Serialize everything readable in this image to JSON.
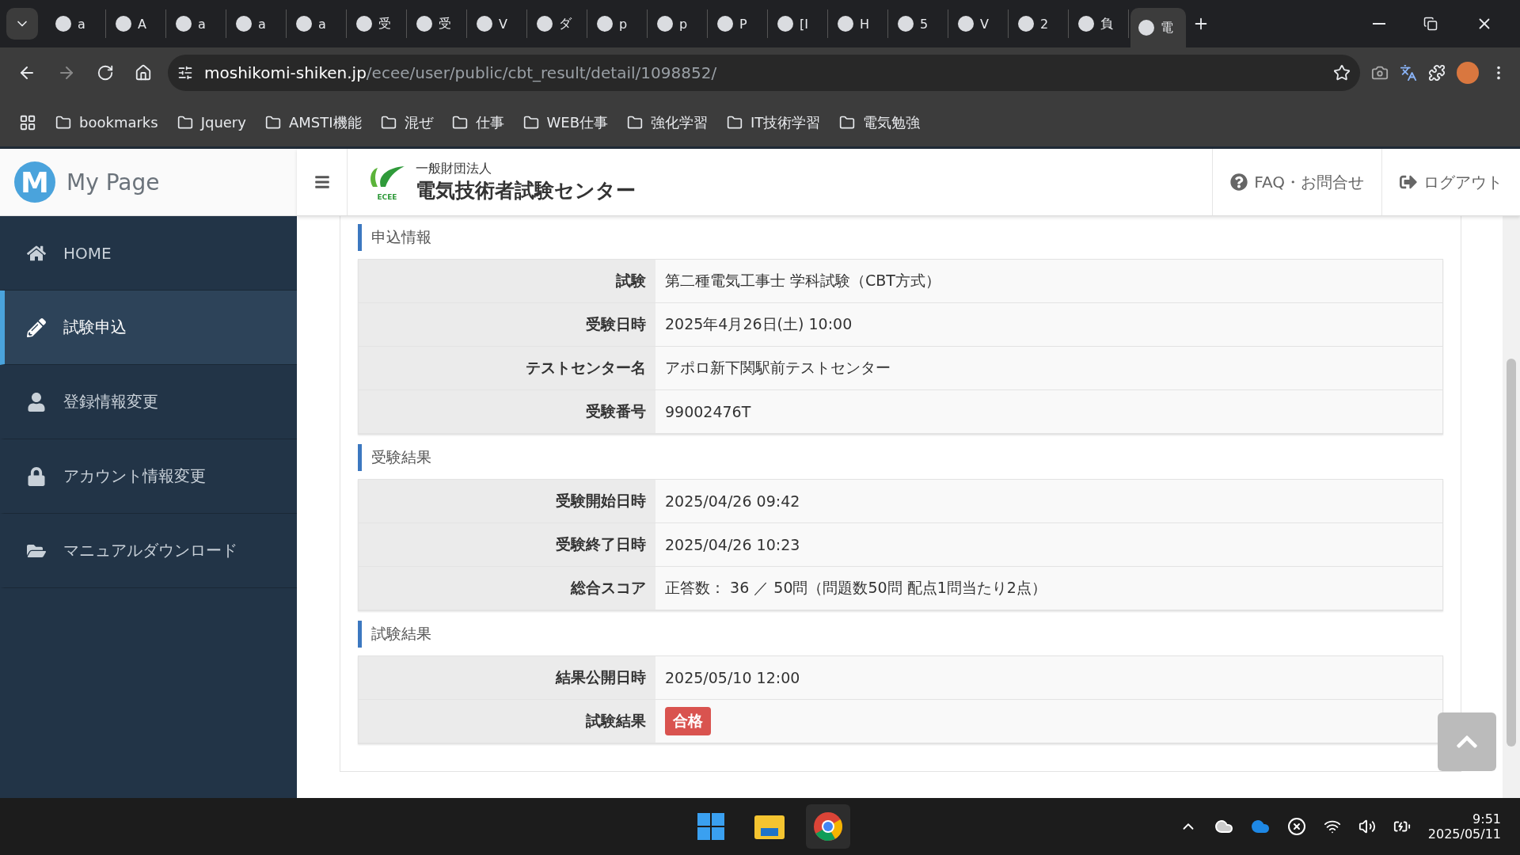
{
  "browser": {
    "tabs": [
      {
        "title": "a",
        "selected": false
      },
      {
        "title": "A",
        "selected": false
      },
      {
        "title": "a",
        "selected": false
      },
      {
        "title": "a",
        "selected": false
      },
      {
        "title": "a",
        "selected": false
      },
      {
        "title": "受",
        "selected": false
      },
      {
        "title": "受",
        "selected": false
      },
      {
        "title": "V",
        "selected": false
      },
      {
        "title": "ダ",
        "selected": false
      },
      {
        "title": "p",
        "selected": false
      },
      {
        "title": "p",
        "selected": false
      },
      {
        "title": "P",
        "selected": false
      },
      {
        "title": "[I",
        "selected": false
      },
      {
        "title": "H",
        "selected": false
      },
      {
        "title": "5",
        "selected": false
      },
      {
        "title": "V",
        "selected": false
      },
      {
        "title": "2",
        "selected": false
      },
      {
        "title": "負",
        "selected": false
      },
      {
        "title": "電",
        "selected": true
      }
    ],
    "url": {
      "host": "moshikomi-shiken.jp",
      "path": "/ecee/user/public/cbt_result/detail/1098852/"
    },
    "bookmarks": [
      "bookmarks",
      "Jquery",
      "AMSTI機能",
      "混ぜ",
      "仕事",
      "WEB仕事",
      "強化学習",
      "IT技術学習",
      "電気勉強"
    ]
  },
  "brand": {
    "logo_letter": "M",
    "title": "My Page"
  },
  "organization": {
    "subtitle": "一般財団法人",
    "name": "電気技術者試験センター",
    "logo_text": "ECEE"
  },
  "header_links": [
    {
      "kind": "faq",
      "label": "FAQ・お問合せ"
    },
    {
      "kind": "logout",
      "label": "ログアウト"
    }
  ],
  "sidebar": {
    "items": [
      {
        "kind": "home",
        "label": "HOME",
        "selected": false
      },
      {
        "kind": "pencil",
        "label": "試験申込",
        "selected": true
      },
      {
        "kind": "user",
        "label": "登録情報変更",
        "selected": false
      },
      {
        "kind": "lock",
        "label": "アカウント情報変更",
        "selected": false
      },
      {
        "kind": "folder",
        "label": "マニュアルダウンロード",
        "selected": false
      }
    ]
  },
  "sections": [
    {
      "title": "申込情報",
      "rows": [
        {
          "label": "試験",
          "value": "第二種電気工事士 学科試験（CBT方式）",
          "kind": "text"
        },
        {
          "label": "受験日時",
          "value": "2025年4月26日(土) 10:00",
          "kind": "text"
        },
        {
          "label": "テストセンター名",
          "value": "アポロ新下関駅前テストセンター",
          "kind": "text"
        },
        {
          "label": "受験番号",
          "value": "99002476T",
          "kind": "text"
        }
      ]
    },
    {
      "title": "受験結果",
      "rows": [
        {
          "label": "受験開始日時",
          "value": "2025/04/26 09:42",
          "kind": "text"
        },
        {
          "label": "受験終了日時",
          "value": "2025/04/26 10:23",
          "kind": "text"
        },
        {
          "label": "総合スコア",
          "value": "正答数： 36 ／ 50問（問題数50問 配点1問当たり2点）",
          "kind": "text"
        }
      ]
    },
    {
      "title": "試験結果",
      "rows": [
        {
          "label": "結果公開日時",
          "value": "2025/05/10 12:00",
          "kind": "text"
        },
        {
          "label": "試験結果",
          "value": "合格",
          "kind": "badge"
        }
      ]
    }
  ],
  "taskbar": {
    "time": "9:51",
    "date": "2025/05/11"
  }
}
